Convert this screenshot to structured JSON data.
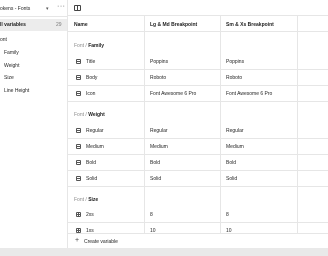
{
  "sidebar": {
    "collection": "okens - Fonts",
    "all_variables": "ll variables",
    "all_variables_count": "29",
    "group": "ont",
    "items": [
      "Family",
      "Weight",
      "Size",
      "Line Height"
    ]
  },
  "table": {
    "columns": [
      "Name",
      "Lg & Md Breakpoint",
      "Sm & Xs Breakpoint"
    ],
    "sections": [
      {
        "prefix": "Font /",
        "title": "Family",
        "rows": [
          {
            "name": "Title",
            "v1": "Poppins",
            "v2": "Poppins"
          },
          {
            "name": "Body",
            "v1": "Roboto",
            "v2": "Roboto"
          },
          {
            "name": "Icon",
            "v1": "Font Awesome 6 Pro",
            "v2": "Font Awesome 6 Pro"
          }
        ]
      },
      {
        "prefix": "Font /",
        "title": "Weight",
        "rows": [
          {
            "name": "Regular",
            "v1": "Regular",
            "v2": "Regular"
          },
          {
            "name": "Medium",
            "v1": "Medium",
            "v2": "Medium"
          },
          {
            "name": "Bold",
            "v1": "Bold",
            "v2": "Bold"
          },
          {
            "name": "Solid",
            "v1": "Solid",
            "v2": "Solid"
          }
        ]
      },
      {
        "prefix": "Font /",
        "title": "Size",
        "rows": [
          {
            "name": "2xs",
            "v1": "8",
            "v2": "8"
          },
          {
            "name": "1xs",
            "v1": "10",
            "v2": "10"
          }
        ]
      }
    ],
    "create_label": "Create variable"
  },
  "icons": {
    "string_variable": "string-variable-icon",
    "number_variable": "number-variable-icon",
    "panel_toggle": "panel-toggle-icon",
    "more": "more-icon",
    "add": "plus-icon"
  }
}
